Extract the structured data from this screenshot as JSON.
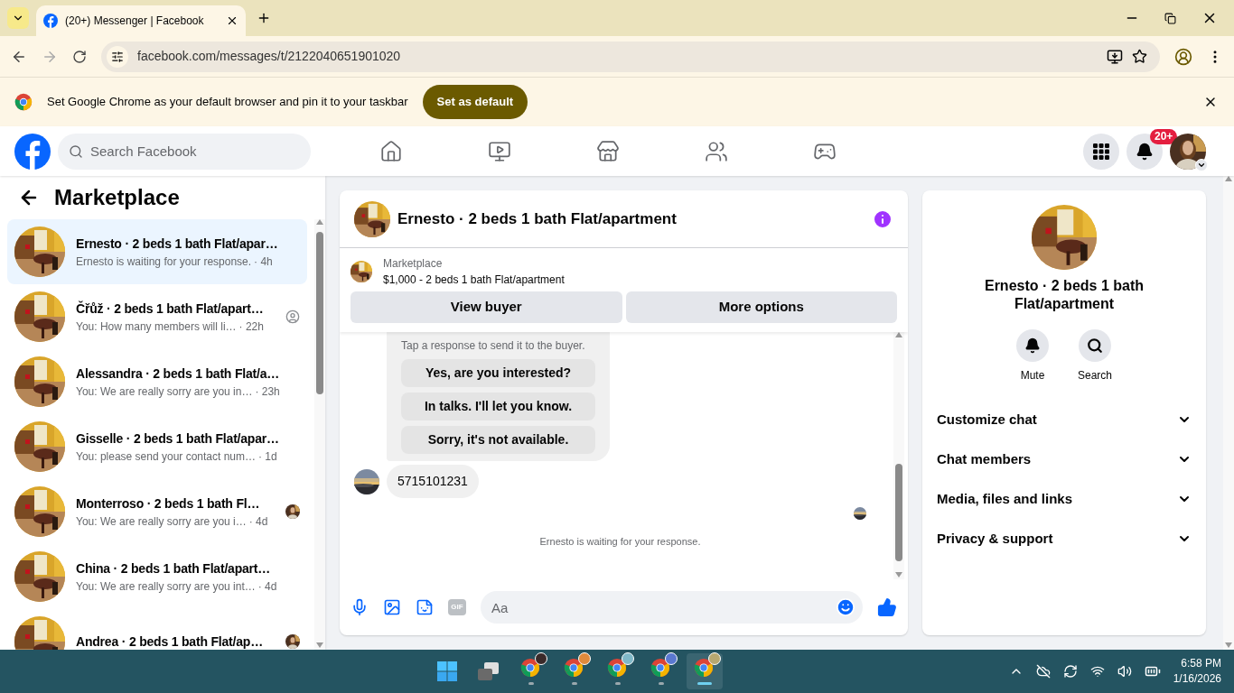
{
  "browser": {
    "tab_title": "(20+) Messenger | Facebook",
    "url": "facebook.com/messages/t/2122040651901020",
    "infobar": {
      "text": "Set Google Chrome as your default browser and pin it to your taskbar",
      "button": "Set as default"
    }
  },
  "header": {
    "search_placeholder": "Search Facebook",
    "nav": [
      {
        "kind": "home",
        "selected": false
      },
      {
        "kind": "video",
        "selected": false
      },
      {
        "kind": "marketplace",
        "selected": false
      },
      {
        "kind": "groups",
        "selected": false
      },
      {
        "kind": "gaming",
        "selected": false
      }
    ],
    "notification_badge": "20+"
  },
  "sidebar": {
    "title": "Marketplace",
    "conversations": [
      {
        "name": "Ernesto · 2 beds 1 bath Flat/apar…",
        "preview": "Ernesto is waiting for your response.",
        "time": "· 4h",
        "selected": true
      },
      {
        "name": "Čřůž · 2 beds 1 bath Flat/apart…",
        "preview": "You: How many members will li…",
        "time": "· 22h",
        "selected": false,
        "seen": {
          "kind": "person"
        }
      },
      {
        "name": "Alessandra · 2 beds 1 bath Flat/a…",
        "preview": "You: We are really sorry are you in…",
        "time": "· 23h",
        "selected": false
      },
      {
        "name": "Gisselle · 2 beds 1 bath Flat/apar…",
        "preview": "You: please send your contact num…",
        "time": "· 1d",
        "selected": false
      },
      {
        "name": "Monterroso · 2 beds 1 bath Fl…",
        "preview": "You: We are really sorry are you i…",
        "time": "· 4d",
        "selected": false
      },
      {
        "name": "China · 2 beds 1 bath Flat/apart…",
        "preview": "You: We are really sorry are you int…",
        "time": "· 4d",
        "selected": false
      },
      {
        "name": "Andrea · 2 beds 1 bath Flat/ap…",
        "selected": false
      }
    ]
  },
  "chat": {
    "title": "Ernesto · 2 beds 1 bath Flat/apartment",
    "listing": {
      "label": "Marketplace",
      "price_title": "$1,000 - 2 beds 1 bath Flat/apartment",
      "buttons": [
        "View buyer",
        "More options"
      ]
    },
    "quick_response": {
      "subtitle": "Tap a response to send it to the buyer.",
      "options": [
        "Yes, are you interested?",
        "In talks. I'll let you know.",
        "Sorry, it's not available."
      ]
    },
    "messages": [
      {
        "text": "5715101231"
      }
    ],
    "status": "Ernesto is waiting for your response.",
    "composer": {
      "gif": "GIF",
      "placeholder": "Aa"
    }
  },
  "details": {
    "name": "Ernesto · 2 beds 1 bath Flat/apartment",
    "actions": [
      {
        "kind": "mute",
        "label": "Mute"
      },
      {
        "kind": "search",
        "label": "Search"
      }
    ],
    "sections": [
      {
        "label": "Customize chat",
        "expanded": false
      },
      {
        "label": "Chat members",
        "expanded": false
      },
      {
        "label": "Media, files and links",
        "expanded": false
      },
      {
        "label": "Privacy & support",
        "expanded": false
      }
    ]
  },
  "taskbar": {
    "chrome_windows": [
      {
        "selected": false,
        "color": "#3a2a2a"
      },
      {
        "selected": false,
        "color": "#e08a3c"
      },
      {
        "selected": false,
        "color": "#7fb8c8"
      },
      {
        "selected": false,
        "color": "#5a78d0"
      },
      {
        "selected": true,
        "color": "#b8a870"
      }
    ],
    "time": "6:58 PM",
    "date": "1/16/2026"
  }
}
